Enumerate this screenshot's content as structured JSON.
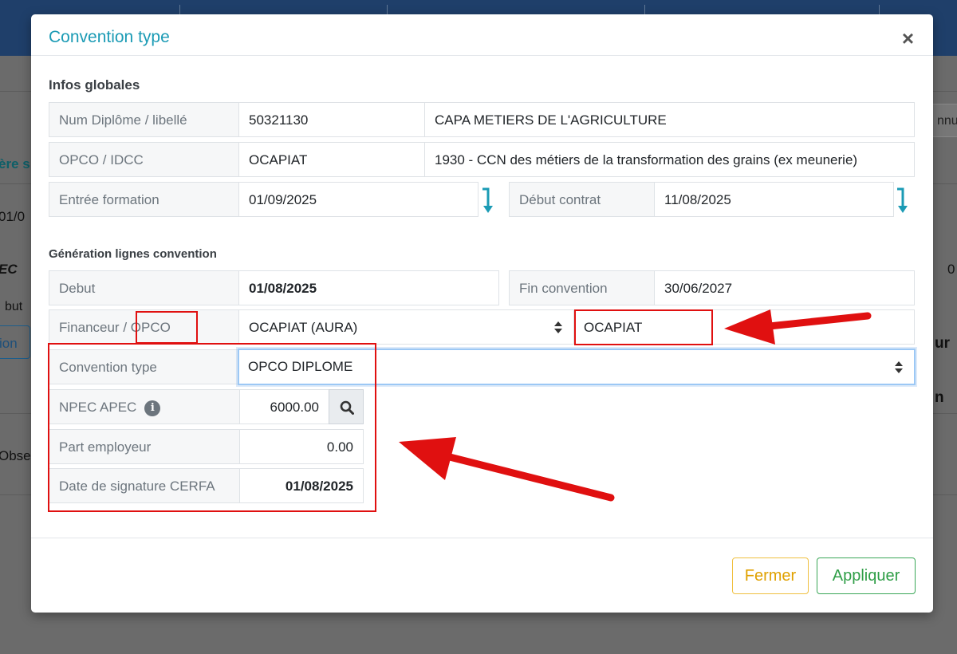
{
  "background": {
    "left_fragments": [
      "ère s",
      "01/0",
      "EC",
      "but",
      "ion",
      "Obse"
    ],
    "right_fragments": [
      "nnul",
      "0",
      "ur",
      "n"
    ]
  },
  "modal": {
    "title": "Convention type",
    "close_glyph": "×",
    "infos_globales": {
      "heading": "Infos globales",
      "rows": [
        {
          "label": "Num Diplôme / libellé",
          "value": "50321130",
          "value2": "CAPA METIERS DE L'AGRICULTURE"
        },
        {
          "label": "OPCO / IDCC",
          "value": "OCAPIAT",
          "value2": "1930 - CCN des métiers de la transformation des grains (ex meunerie)"
        }
      ],
      "entree_formation": {
        "label": "Entrée formation",
        "value": "01/09/2025"
      },
      "debut_contrat": {
        "label": "Début contrat",
        "value": "11/08/2025"
      }
    },
    "generation": {
      "heading": "Génération lignes convention",
      "debut": {
        "label": "Debut",
        "value": "01/08/2025"
      },
      "fin_convention": {
        "label": "Fin convention",
        "value": "30/06/2027"
      },
      "financeur": {
        "label_prefix": "Financeur / ",
        "label_highlight": "OPCO",
        "selected": "OCAPIAT (AURA)",
        "opco_value": "OCAPIAT"
      },
      "convention_type": {
        "label": "Convention type",
        "selected": "OPCO DIPLOME"
      },
      "npec_apec": {
        "label": "NPEC APEC",
        "info_glyph": "i",
        "value": "6000.00"
      },
      "part_employeur": {
        "label": "Part employeur",
        "value": "0.00"
      },
      "date_signature": {
        "label": "Date de signature CERFA",
        "value": "01/08/2025"
      }
    },
    "footer": {
      "fermer_label": "Fermer",
      "appliquer_label": "Appliquer"
    }
  },
  "colors": {
    "title": "#1b9bb5",
    "accent_arrow": "#1b9bb5",
    "annotation_red": "#e01010",
    "fermer": "#e0a100",
    "appliquer": "#2f9e47"
  },
  "icons": [
    "close-icon",
    "arrow-down-return-icon",
    "caret-select-icon",
    "info-icon",
    "search-icon"
  ]
}
